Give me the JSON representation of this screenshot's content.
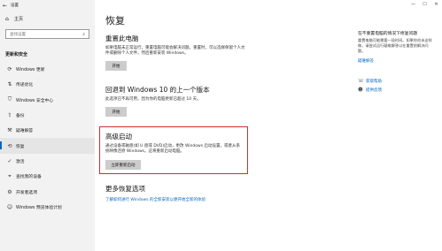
{
  "window": {
    "title": "设置",
    "back_icon": "←",
    "controls": [
      "—",
      "☐",
      "✕"
    ]
  },
  "sidebar": {
    "home": {
      "icon": "⌂",
      "label": "主页"
    },
    "search": {
      "placeholder": "查找设置",
      "icon": "⌕"
    },
    "section_title": "更新和安全",
    "items": [
      {
        "icon": "⟳",
        "label": "Windows 更新"
      },
      {
        "icon": "⇅",
        "label": "传递优化"
      },
      {
        "icon": "⛉",
        "label": "Windows 安全中心"
      },
      {
        "icon": "⇪",
        "label": "备份"
      },
      {
        "icon": "⚒",
        "label": "疑难解答"
      },
      {
        "icon": "⟲",
        "label": "恢复",
        "active": true
      },
      {
        "icon": "✓",
        "label": "激活"
      },
      {
        "icon": "⌖",
        "label": "查找我的设备"
      },
      {
        "icon": "⚙",
        "label": "开发者选项"
      },
      {
        "icon": "☺",
        "label": "Windows 预览体验计划"
      }
    ]
  },
  "main": {
    "title": "恢复",
    "reset": {
      "heading": "重置此电脑",
      "desc": "如果电脑未正常运行，重置电脑可能会解决问题。重置时，可以选择保留个人文件或删除个人文件，然后重新安装 Windows。",
      "button": "开始"
    },
    "rollback": {
      "heading": "回退到 Windows 10 的上一个版本",
      "desc": "此选项已不再可用，因为你的电脑更新已超过 10 天。",
      "button": "开始"
    },
    "advanced": {
      "heading": "高级启动",
      "desc": "通过设备或磁盘(如 U 盘或 DVD)启动，更改 Windows 启动设置，或者从系统映像还原 Windows。这将重新启动电脑。",
      "button": "立即重新启动"
    },
    "more": {
      "heading": "更多恢复选项",
      "link": "了解如何进行 Windows 的全新安装以便开始全新的体验"
    }
  },
  "right": {
    "heading": "在不重置电脑的情况下修复问题",
    "desc": "重置电脑可能需要一段时间。如果你尚未这样做，请尝试运行疑难解答以在重置前解决问题。",
    "link": "疑难解答",
    "help_heading": "获取帮助",
    "help_icon": "☏",
    "feedback_icon": "☻",
    "feedback": "提供反馈"
  },
  "colors": {
    "accent": "#0067c0",
    "highlight_box": "#c8332f",
    "button": "#cccccc",
    "sidebar_bg": "#f2f2f2"
  }
}
